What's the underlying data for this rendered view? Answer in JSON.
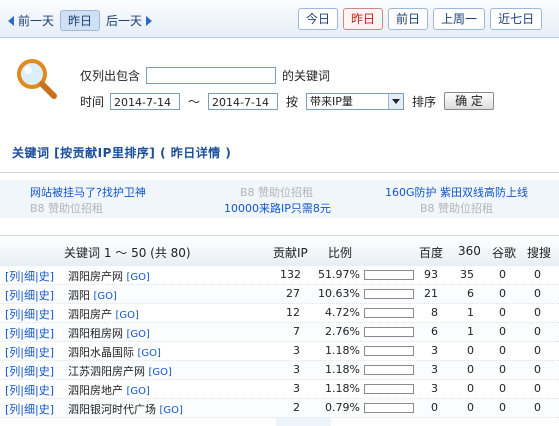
{
  "nav": {
    "prev_day": "前一天",
    "yesterday": "昨日",
    "next_day": "后一天"
  },
  "tabs": {
    "today": "今日",
    "yesterday": "昨日",
    "day_before": "前日",
    "last_week": "上周一",
    "last_seven": "近七日"
  },
  "filter": {
    "only_contains": "仅列出包含",
    "keyword_suffix": "的关键词",
    "keyword_value": "",
    "time_label": "时间",
    "date_from": "2014-7-14",
    "tilde": "～",
    "date_to": "2014-7-14",
    "by_label": "按",
    "sort_select": "带来IP量",
    "sort_label": "排序",
    "confirm": "确 定"
  },
  "section_title": "关键词 [按贡献IP里排序] ( 昨日详情 )",
  "ads": {
    "a1": "网站被挂马了?找护卫神",
    "a2": "B8 赞助位招租",
    "a3": "160G防护 紫田双线高防上线",
    "a4": "B8 赞助位招租",
    "a5": "10000来路IP只需8元",
    "a6": "B8 赞助位招租"
  },
  "table": {
    "headers": {
      "keyword": "关键词 1 ～ 50 (共 80)",
      "contrib_ip": "贡献IP",
      "ratio": "比例",
      "baidu": "百度",
      "s360": "360",
      "google": "谷歌",
      "sogou": "搜搜"
    },
    "link_labels": "[列|细|史]",
    "go_label": "[GO]",
    "rows": [
      {
        "keyword": "泗阳房产网",
        "ip": "132",
        "ratio": "51.97%",
        "pct": 0.5197,
        "baidu": "93",
        "s360": "35",
        "google": "0",
        "sogou": "0"
      },
      {
        "keyword": "泗阳",
        "ip": "27",
        "ratio": "10.63%",
        "pct": 0.1063,
        "baidu": "21",
        "s360": "6",
        "google": "0",
        "sogou": "0"
      },
      {
        "keyword": "泗阳房产",
        "ip": "12",
        "ratio": "4.72%",
        "pct": 0.0472,
        "baidu": "8",
        "s360": "1",
        "google": "0",
        "sogou": "0"
      },
      {
        "keyword": "泗阳租房网",
        "ip": "7",
        "ratio": "2.76%",
        "pct": 0.0276,
        "baidu": "6",
        "s360": "1",
        "google": "0",
        "sogou": "0"
      },
      {
        "keyword": "泗阳水晶国际",
        "ip": "3",
        "ratio": "1.18%",
        "pct": 0.0118,
        "baidu": "3",
        "s360": "0",
        "google": "0",
        "sogou": "0"
      },
      {
        "keyword": "江苏泗阳房产网",
        "ip": "3",
        "ratio": "1.18%",
        "pct": 0.0118,
        "baidu": "3",
        "s360": "0",
        "google": "0",
        "sogou": "0"
      },
      {
        "keyword": "泗阳房地产",
        "ip": "3",
        "ratio": "1.18%",
        "pct": 0.0118,
        "baidu": "3",
        "s360": "0",
        "google": "0",
        "sogou": "0"
      },
      {
        "keyword": "泗阳银河时代广场",
        "ip": "2",
        "ratio": "0.79%",
        "pct": 0.0079,
        "baidu": "0",
        "s360": "0",
        "google": "0",
        "sogou": "0"
      }
    ]
  },
  "colors": {
    "accent": "#1b4e9b",
    "active_tab": "#d21a1a",
    "bar_fill": "#1aa51a"
  }
}
